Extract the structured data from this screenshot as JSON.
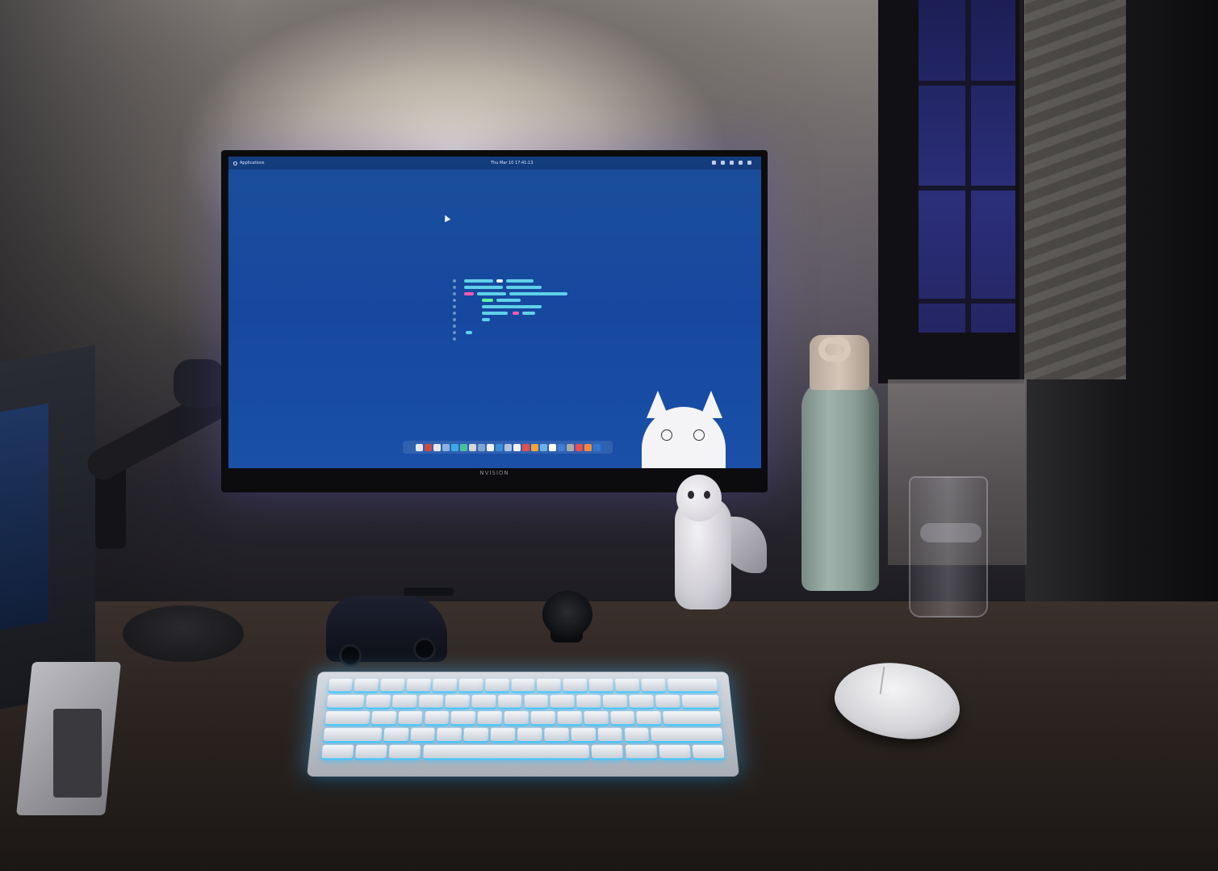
{
  "screen": {
    "topbar": {
      "applications_label": "Applications",
      "clock": "Thu Mar 10   17:41:13"
    },
    "code_lines": [
      {
        "bars": [
          {
            "x": 14,
            "w": 36,
            "c": "#5fd1e8"
          },
          {
            "x": 54,
            "w": 8,
            "c": "#e8f0ff"
          },
          {
            "x": 66,
            "w": 34,
            "c": "#5fd1e8"
          }
        ]
      },
      {
        "bars": [
          {
            "x": 14,
            "w": 48,
            "c": "#5fd1e8"
          },
          {
            "x": 66,
            "w": 44,
            "c": "#5fd1e8"
          }
        ]
      },
      {
        "bars": [
          {
            "x": 14,
            "w": 12,
            "c": "#ff5ab4"
          },
          {
            "x": 30,
            "w": 36,
            "c": "#5fd1e8"
          },
          {
            "x": 70,
            "w": 72,
            "c": "#5fd1e8"
          }
        ]
      },
      {
        "bars": [
          {
            "x": 36,
            "w": 14,
            "c": "#62f0a0"
          },
          {
            "x": 54,
            "w": 30,
            "c": "#5fd1e8"
          }
        ]
      },
      {
        "bars": [
          {
            "x": 36,
            "w": 74,
            "c": "#5fd1e8"
          }
        ]
      },
      {
        "bars": [
          {
            "x": 36,
            "w": 32,
            "c": "#5fd1e8"
          },
          {
            "x": 74,
            "w": 8,
            "c": "#ff5ab4"
          },
          {
            "x": 86,
            "w": 16,
            "c": "#5fd1e8"
          }
        ]
      },
      {
        "bars": [
          {
            "x": 36,
            "w": 10,
            "c": "#5fd1e8"
          }
        ]
      },
      {
        "bars": []
      },
      {
        "bars": [
          {
            "x": 16,
            "w": 8,
            "c": "#5fd1e8"
          }
        ]
      },
      {
        "bars": []
      }
    ],
    "dock_icons": [
      "#e4e8ee",
      "#c94b4b",
      "#e7e7e7",
      "#8bb0e3",
      "#3ea8e6",
      "#47c39c",
      "#d8d8d8",
      "#7aa7d6",
      "#f0f0f0",
      "#3b8fd8",
      "#b0c4de",
      "#f2f2f2",
      "#e0524f",
      "#f6a33a",
      "#6bb2f0",
      "#ffffff",
      "#3f7fd1",
      "#aaaaaa",
      "#e94f4f",
      "#f28a3a",
      "#2f77d6"
    ],
    "monitor_brand": "NVISION"
  },
  "colors": {
    "screen_blue": "#1a4f9b",
    "keyboard_glow": "#3cc8ff"
  }
}
